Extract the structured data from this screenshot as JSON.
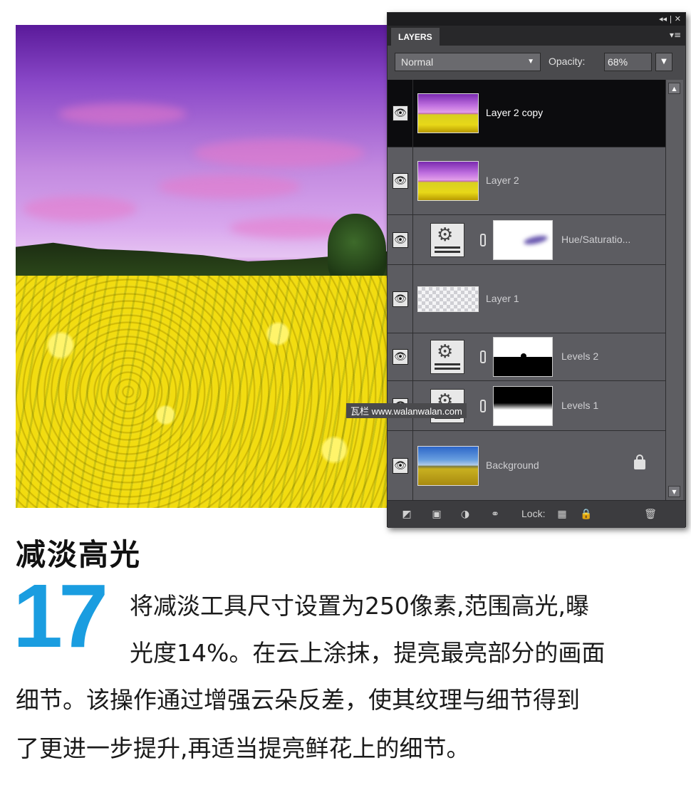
{
  "panel": {
    "tab_label": "LAYERS",
    "titlebar_controls": "◂◂ | ✕",
    "menu_glyph": "▾≡",
    "blend_mode": "Normal",
    "opacity_label": "Opacity:",
    "opacity_value": "68%",
    "layers": [
      {
        "name": "Layer 2 copy",
        "thumb": "photo",
        "selected": true,
        "visible": true
      },
      {
        "name": "Layer 2",
        "thumb": "photo",
        "selected": false,
        "visible": true
      },
      {
        "name": "Hue/Saturatio...",
        "thumb": "adjustment",
        "mask": "hue",
        "selected": false,
        "visible": true
      },
      {
        "name": "Layer 1",
        "thumb": "transparent",
        "selected": false,
        "visible": true
      },
      {
        "name": "Levels 2",
        "thumb": "adjustment",
        "mask": "levels",
        "selected": false,
        "visible": true
      },
      {
        "name": "Levels 1",
        "thumb": "adjustment",
        "mask": "levels",
        "selected": false,
        "visible": true
      },
      {
        "name": "Background",
        "thumb": "background",
        "locked": true,
        "selected": false,
        "visible": true
      }
    ],
    "footer": {
      "lock_label": "Lock:"
    },
    "icons": {
      "new_layer": "new-layer-icon",
      "new_fill": "mask-icon",
      "adjustment": "adjustment-layer-icon",
      "link": "link-icon",
      "lock_transparent": "lock-transparency-icon",
      "lock_all": "lock-icon",
      "delete": "trash-icon",
      "eye": "eye-icon"
    }
  },
  "watermark": "瓦栏 www.walanwalan.com",
  "article": {
    "heading": "减淡高光",
    "step_number": "17",
    "lines": [
      "将减淡工具尺寸设置为250像素,范围高光,曝",
      "光度14%。在云上涂抹，提亮最亮部分的画面",
      "细节。该操作通过增强云朵反差，使其纹理与细节得到",
      "了更进一步提升,再适当提亮鲜花上的细节。"
    ]
  },
  "colors": {
    "accent_blue": "#1a9de0",
    "panel_bg": "#4a4a4d",
    "selected_row": "#0c0c0e"
  }
}
